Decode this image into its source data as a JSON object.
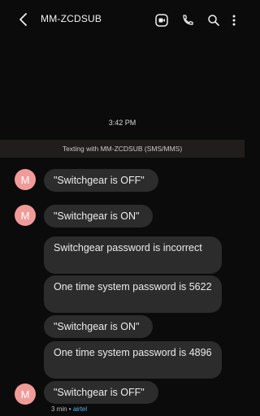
{
  "header": {
    "title": "MM-ZCDSUB",
    "icons": [
      "back-arrow-icon",
      "video-call-icon",
      "phone-icon",
      "search-icon",
      "more-vert-icon"
    ]
  },
  "timestamp": "3:42 PM",
  "info_bar": "Texting with MM-ZCDSUB (SMS/MMS)",
  "avatar_letter": "M",
  "messages": [
    {
      "text": "\"Switchgear is OFF\"",
      "avatar": true
    },
    {
      "text": "\"Switchgear is ON\"",
      "avatar": true
    },
    {
      "text": "Switchgear password is incorrect",
      "avatar": false
    },
    {
      "text": "One time system password is 5622",
      "avatar": false
    },
    {
      "text": "\"Switchgear is ON\"",
      "avatar": false
    },
    {
      "text": "One time system password is 4896",
      "avatar": false
    },
    {
      "text": "\"Switchgear is OFF\"",
      "avatar": true
    }
  ],
  "last_meta": {
    "time": "3 min",
    "separator": " • ",
    "carrier": "airtel"
  },
  "colors": {
    "background": "#0b0b0b",
    "bubble": "#2c2c2c",
    "avatar": "#f19b99",
    "info_bar": "#221d1d",
    "carrier": "#5ab0e6"
  }
}
